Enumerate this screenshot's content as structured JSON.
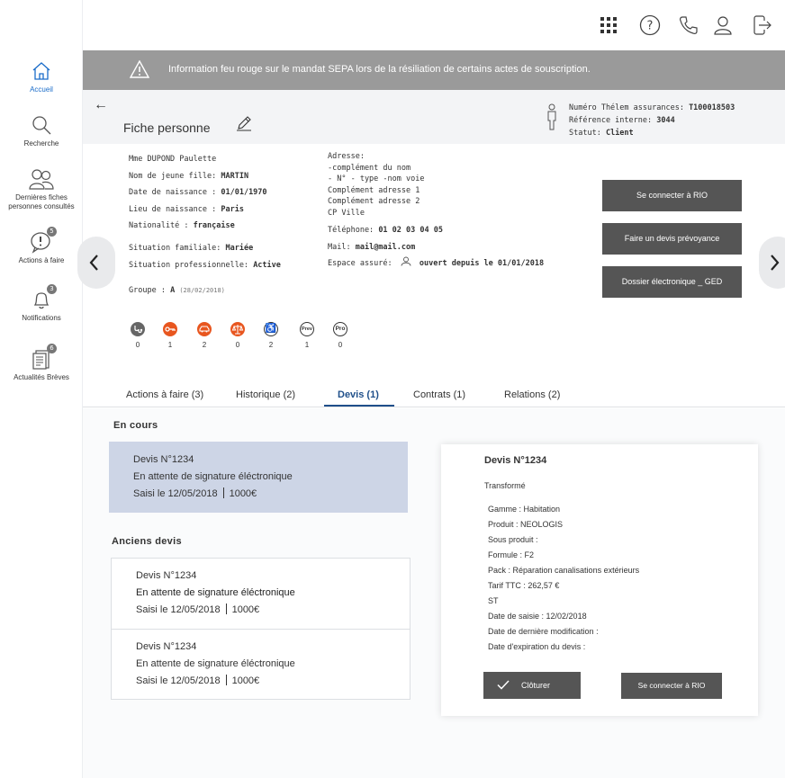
{
  "sidebar": {
    "items": [
      {
        "label": "Accueil"
      },
      {
        "label": "Recherche"
      },
      {
        "label": "Dernières fiches",
        "label2": "personnes consultés"
      },
      {
        "label": "Actions à faire",
        "badge": "5"
      },
      {
        "label": "Notifications",
        "badge": "3"
      },
      {
        "label": "Actualités Brèves",
        "badge": "6"
      }
    ]
  },
  "banner": {
    "text": "Information feu rouge sur le mandat SEPA lors de la résiliation de certains actes de souscription."
  },
  "header": {
    "back": "←",
    "title": "Fiche personne",
    "meta": {
      "numero_label": "Numéro Thélem assurances:",
      "numero_value": "T100018503",
      "ref_label": "Référence interne:",
      "ref_value": "3044",
      "statut_label": "Statut:",
      "statut_value": "Client"
    }
  },
  "person": {
    "name": "Mme DUPOND Paulette",
    "maiden_label": "Nom de jeune fille:",
    "maiden_value": "MARTIN",
    "birth_label": "Date de naissance :",
    "birth_value": "01/01/1970",
    "birthplace_label": "Lieu de naissance :",
    "birthplace_value": "Paris",
    "nationality_label": "Nationalité :",
    "nationality_value": "française",
    "family_label": "Situation familiale:",
    "family_value": "Mariée",
    "pro_label": "Situation professionnelle:",
    "pro_value": "Active",
    "group_label": "Groupe :",
    "group_value": "A",
    "group_date": "(28/02/2018)"
  },
  "address": {
    "lines": [
      "Adresse:",
      "-complément du nom",
      "- N° - type -nom voie",
      "Complément adresse 1",
      "Complément adresse 2",
      "CP Ville"
    ],
    "phone_label": "Téléphone:",
    "phone_value": "01 02 03 04 05",
    "mail_label": "Mail:",
    "mail_value": "mail@mail.com",
    "space_label": "Espace assuré:",
    "space_value": "ouvert depuis le 01/01/2018"
  },
  "actions": {
    "rio": "Se connecter à RIO",
    "prevoyance": "Faire un devis prévoyance",
    "ged": "Dossier électronique _ GED"
  },
  "stats": [
    {
      "icon": "stethoscope-icon",
      "value": "0",
      "color": "#666666"
    },
    {
      "icon": "key-icon",
      "value": "1",
      "color": "#e8561f"
    },
    {
      "icon": "car-icon",
      "value": "2",
      "color": "#e8561f"
    },
    {
      "icon": "scale-icon",
      "value": "0",
      "color": "#e8561f"
    },
    {
      "icon": "wheelchair-icon",
      "value": "2",
      "color": "#333333",
      "glyph": "♿"
    },
    {
      "icon": "prev-icon",
      "value": "1",
      "color": "#333333",
      "glyph": "Prev"
    },
    {
      "icon": "pro-icon",
      "value": "0",
      "color": "#333333",
      "glyph": "Pro"
    }
  ],
  "tabs": [
    {
      "label": "Actions à faire (3)"
    },
    {
      "label": "Historique (2)"
    },
    {
      "label": "Devis (1)"
    },
    {
      "label": "Contrats (1)"
    },
    {
      "label": "Relations (2)"
    }
  ],
  "en_cours": {
    "title": "En cours",
    "card": {
      "title": "Devis N°1234",
      "status": "En attente de signature éléctronique",
      "date": "Saisi le 12/05/2018",
      "amount": "1000€"
    }
  },
  "anciens": {
    "title": "Anciens devis",
    "cards": [
      {
        "title": "Devis N°1234",
        "status": "En attente de signature éléctronique",
        "date": "Saisi le 12/05/2018",
        "amount": "1000€"
      },
      {
        "title": "Devis N°1234",
        "status": "En attente de signature éléctronique",
        "date": "Saisi le 12/05/2018",
        "amount": "1000€"
      }
    ]
  },
  "detail": {
    "title": "Devis N°1234",
    "status": "Transformé",
    "lines": [
      "Gamme : Habitation",
      "Produit : NEOLOGIS",
      "Sous produit :",
      "Formule : F2",
      "Pack : Réparation canalisations extérieurs",
      "Tarif TTC : 262,57 €",
      "ST",
      "Date de saisie : 12/02/2018",
      "Date de dernière modification :",
      "Date d'expiration du devis :"
    ],
    "close_label": "Clôturer",
    "rio_label": "Se connecter à RIO"
  },
  "colors": {
    "accent": "#1a6cc9",
    "active_tab": "#1f4f8a",
    "selected_card": "#cdd5e6",
    "button": "#555555",
    "banner": "#9a9a9a",
    "orange": "#e8561f"
  }
}
